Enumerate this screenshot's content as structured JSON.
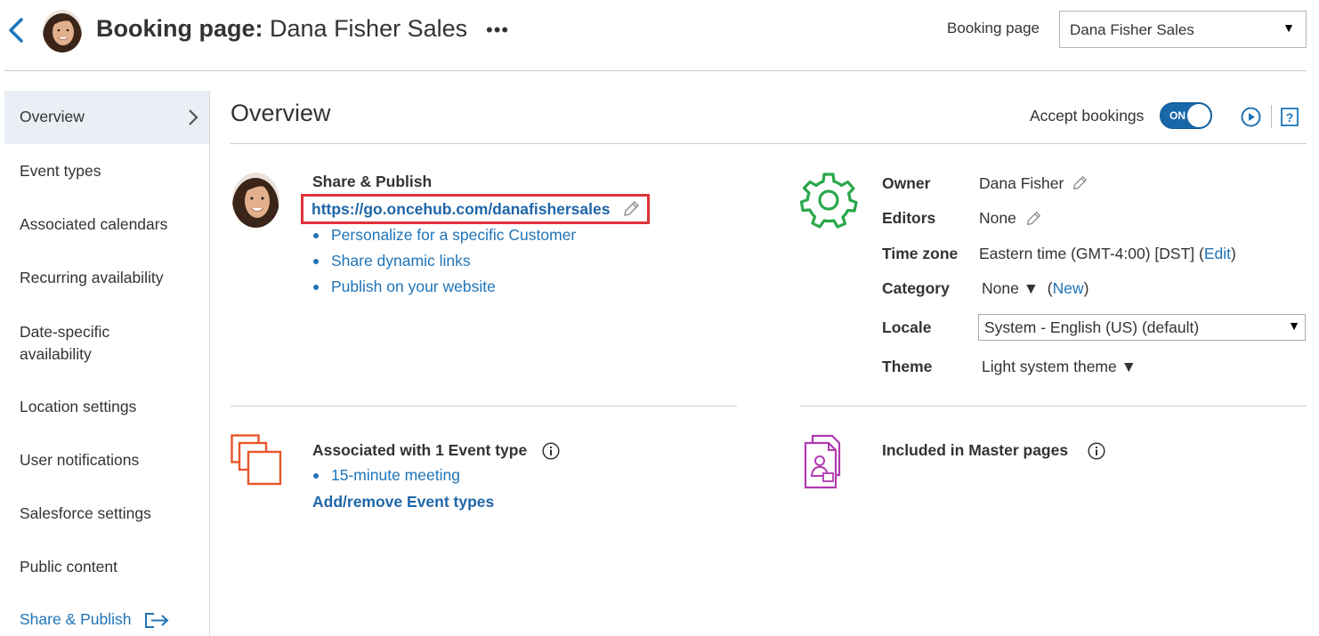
{
  "header": {
    "title_bold": "Booking page:",
    "title_name": "Dana Fisher Sales",
    "more_label": "•••",
    "booking_page_label": "Booking page",
    "booking_page_selected": "Dana Fisher Sales"
  },
  "sidebar": {
    "items": [
      {
        "label": "Overview",
        "active": true
      },
      {
        "label": "Event types"
      },
      {
        "label": "Associated calendars"
      },
      {
        "label": "Recurring availability"
      },
      {
        "label": "Date-specific availability"
      },
      {
        "label": "Location settings"
      },
      {
        "label": "User notifications"
      },
      {
        "label": "Salesforce settings"
      },
      {
        "label": "Public content"
      },
      {
        "label": "Share & Publish"
      }
    ]
  },
  "overview": {
    "title": "Overview",
    "accept_bookings_label": "Accept bookings",
    "toggle_state": "ON"
  },
  "share_publish": {
    "heading": "Share & Publish",
    "url": "https://go.oncehub.com/danafishersales",
    "links": [
      "Personalize for a specific Customer",
      "Share dynamic links",
      "Publish on your website"
    ]
  },
  "properties": {
    "owner_label": "Owner",
    "owner_value": "Dana Fisher",
    "editors_label": "Editors",
    "editors_value": "None",
    "timezone_label": "Time zone",
    "timezone_value": "Eastern time (GMT-4:00) [DST] (",
    "timezone_edit": "Edit",
    "timezone_close": ")",
    "category_label": "Category",
    "category_value": "None ▼",
    "category_open": "(",
    "category_new": "New",
    "category_close": ")",
    "locale_label": "Locale",
    "locale_value": "System - English (US) (default)",
    "theme_label": "Theme",
    "theme_value": "Light system theme ▼"
  },
  "event_types": {
    "heading": "Associated with 1 Event type",
    "items": [
      "15-minute meeting"
    ],
    "add_remove": "Add/remove Event types"
  },
  "master_pages": {
    "heading": "Included in Master pages"
  },
  "colors": {
    "link": "#1f74b8",
    "toggle": "#1867a8",
    "highlight_box": "#e0323a",
    "gear": "#2aa84a",
    "event_icon": "#e8562a",
    "master_icon": "#b03ab0"
  },
  "icons": [
    "back-chevron-icon",
    "more-icon",
    "caret-down-icon",
    "chevron-right-icon",
    "play-icon",
    "help-icon",
    "pencil-icon",
    "gear-icon",
    "info-icon",
    "event-types-icon",
    "master-page-icon",
    "share-out-icon"
  ]
}
